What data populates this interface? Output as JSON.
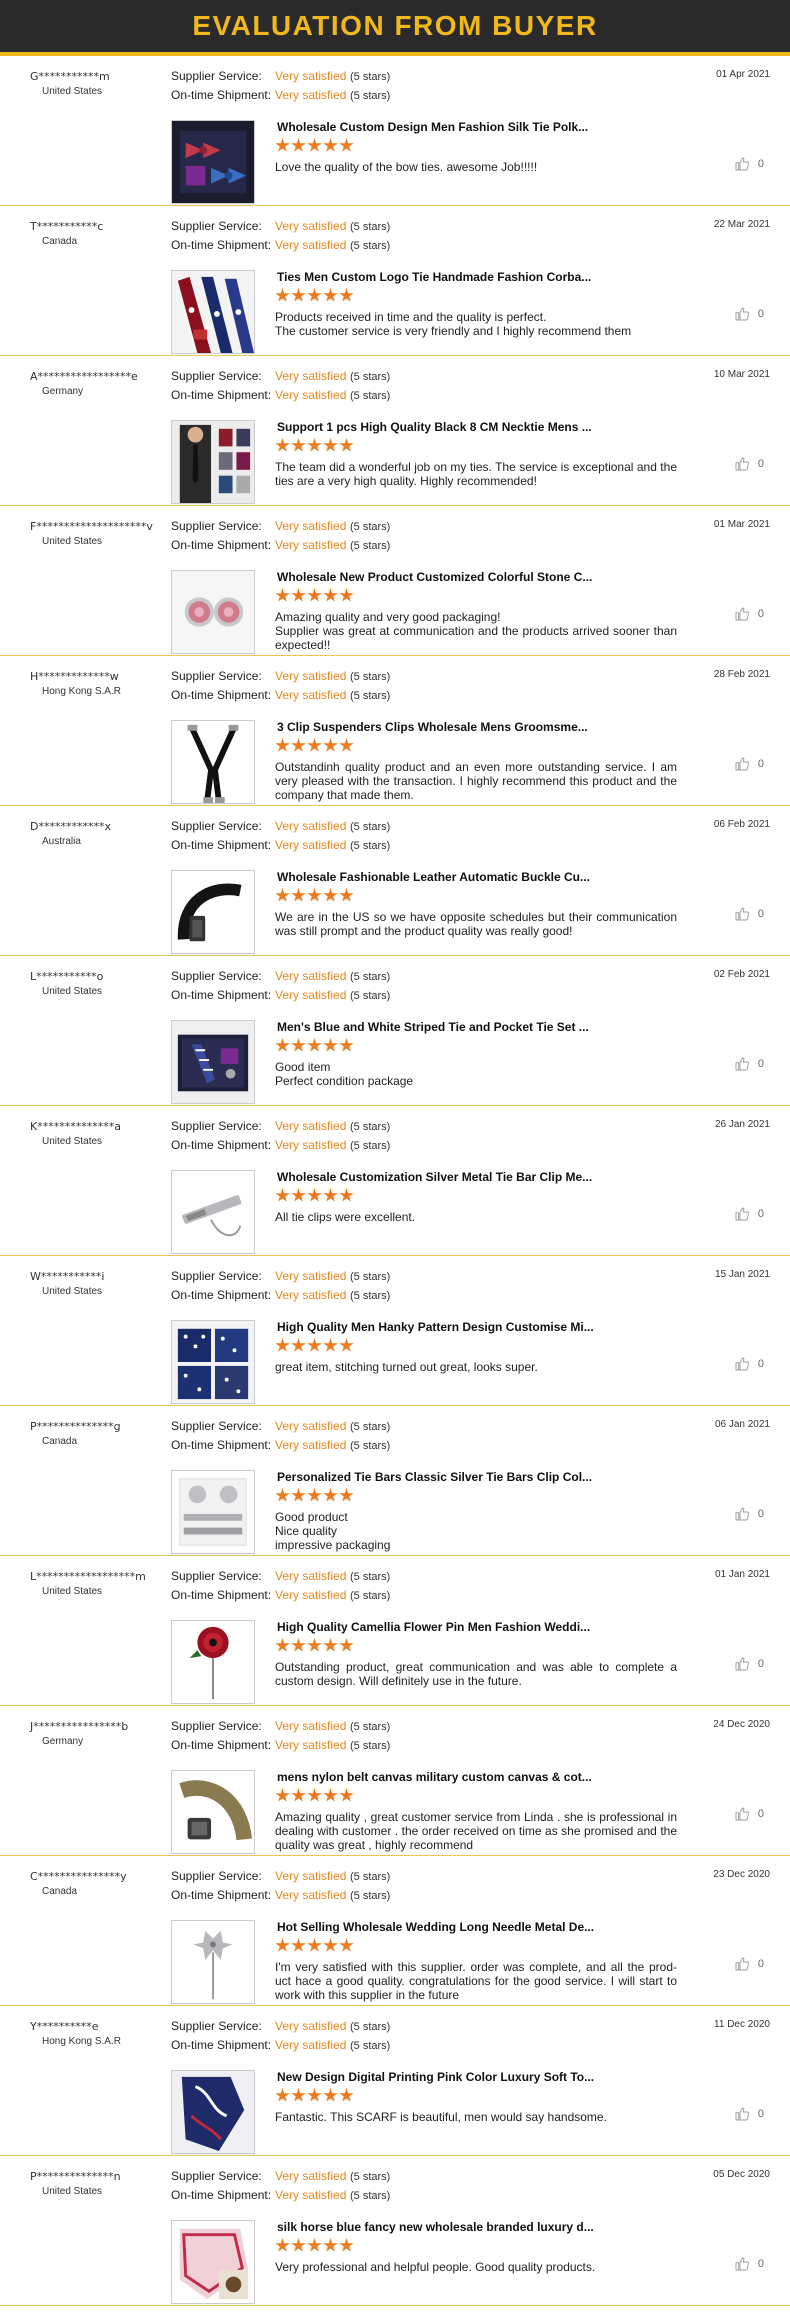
{
  "page_title": "EVALUATION FROM BUYER",
  "labels": {
    "supplier_service": "Supplier Service:",
    "shipment": "On-time Shipment:"
  },
  "colors": {
    "header_bg": "#2a2a2a",
    "accent": "#f0b81a",
    "satisfied": "#e8861a",
    "stars": "#f07b1c"
  },
  "reviews": [
    {
      "buyer": "G***********m",
      "country": "United States",
      "date": "01 Apr 2021",
      "supplier_rating": "Very satisfied",
      "supplier_stars": "(5 stars)",
      "shipment_rating": "Very satisfied",
      "shipment_stars": "(5 stars)",
      "product": "Wholesale Custom Design Men Fashion Silk Tie Polk...",
      "rating": 5,
      "comment": "Love the quality of the bow ties. awesome Job!!!!!",
      "likes": "0",
      "image": "bow-ties-gift-box"
    },
    {
      "buyer": "T***********c",
      "country": "Canada",
      "date": "22 Mar 2021",
      "supplier_rating": "Very satisfied",
      "supplier_stars": "(5 stars)",
      "shipment_rating": "Very satisfied",
      "shipment_stars": "(5 stars)",
      "product": "Ties Men Custom Logo Tie Handmade Fashion Corba...",
      "rating": 5,
      "comment": "Products received in time and the quality is perfect.\nThe customer service is very friendly and I highly recommend them",
      "likes": "0",
      "image": "logo-ties"
    },
    {
      "buyer": "A*****************e",
      "country": "Germany",
      "date": "10 Mar 2021",
      "supplier_rating": "Very satisfied",
      "supplier_stars": "(5 stars)",
      "shipment_rating": "Very satisfied",
      "shipment_stars": "(5 stars)",
      "product": "Support 1 pcs High Quality Black 8 CM Necktie Mens ...",
      "rating": 5,
      "comment": "The team did a wonderful job on my ties. The service is exceptional and the ties are a very high quality. Highly recommended!",
      "likes": "0",
      "image": "man-in-suit-ties"
    },
    {
      "buyer": "F********************v",
      "country": "United States",
      "date": "01 Mar 2021",
      "supplier_rating": "Very satisfied",
      "supplier_stars": "(5 stars)",
      "shipment_rating": "Very satisfied",
      "shipment_stars": "(5 stars)",
      "product": "Wholesale New Product Customized Colorful Stone C...",
      "rating": 5,
      "comment": "Amazing quality and very good packaging!\nSupplier was great at communication and the products arrived sooner than expected!!",
      "likes": "0",
      "image": "stone-cufflinks"
    },
    {
      "buyer": "H*************w",
      "country": "Hong Kong S.A.R",
      "date": "28 Feb 2021",
      "supplier_rating": "Very satisfied",
      "supplier_stars": "(5 stars)",
      "shipment_rating": "Very satisfied",
      "shipment_stars": "(5 stars)",
      "product": "3 Clip Suspenders Clips Wholesale Mens Groomsme...",
      "rating": 5,
      "comment": "Outstandinh quality product and an even more outstanding service. I am very pleased with the transaction. I highly recommend this product and the company that made them.",
      "likes": "0",
      "image": "suspenders"
    },
    {
      "buyer": "D************x",
      "country": "Australia",
      "date": "06 Feb 2021",
      "supplier_rating": "Very satisfied",
      "supplier_stars": "(5 stars)",
      "shipment_rating": "Very satisfied",
      "shipment_stars": "(5 stars)",
      "product": "Wholesale Fashionable Leather Automatic Buckle Cu...",
      "rating": 5,
      "comment": "We are in the US so we have opposite schedules but their communication was still prompt and the product quality was really good!",
      "likes": "0",
      "image": "leather-belt"
    },
    {
      "buyer": "L***********o",
      "country": "United States",
      "date": "02 Feb 2021",
      "supplier_rating": "Very satisfied",
      "supplier_stars": "(5 stars)",
      "shipment_rating": "Very satisfied",
      "shipment_stars": "(5 stars)",
      "product": "Men's Blue and White Striped Tie and Pocket Tie Set ...",
      "rating": 5,
      "comment": "Good item\nPerfect condition package",
      "likes": "0",
      "image": "tie-gift-set"
    },
    {
      "buyer": "K**************a",
      "country": "United States",
      "date": "26 Jan 2021",
      "supplier_rating": "Very satisfied",
      "supplier_stars": "(5 stars)",
      "shipment_rating": "Very satisfied",
      "shipment_stars": "(5 stars)",
      "product": "Wholesale Customization Silver Metal Tie Bar Clip Me...",
      "rating": 5,
      "comment": "All tie clips were excellent.",
      "likes": "0",
      "image": "tie-clip"
    },
    {
      "buyer": "W***********i",
      "country": "United States",
      "date": "15 Jan 2021",
      "supplier_rating": "Very satisfied",
      "supplier_stars": "(5 stars)",
      "shipment_rating": "Very satisfied",
      "shipment_stars": "(5 stars)",
      "product": "High Quality Men Hanky Pattern Design Customise Mi...",
      "rating": 5,
      "comment": "great item, stitching turned out great,  looks super.",
      "likes": "0",
      "image": "hankies"
    },
    {
      "buyer": "P**************g",
      "country": "Canada",
      "date": "06 Jan 2021",
      "supplier_rating": "Very satisfied",
      "supplier_stars": "(5 stars)",
      "shipment_rating": "Very satisfied",
      "shipment_stars": "(5 stars)",
      "product": "Personalized Tie Bars Classic Silver Tie Bars Clip Col...",
      "rating": 5,
      "comment": "Good product\nNice quality\nimpressive packaging",
      "likes": "0",
      "image": "tie-bars-cufflinks"
    },
    {
      "buyer": "L******************m",
      "country": "United States",
      "date": "01 Jan 2021",
      "supplier_rating": "Very satisfied",
      "supplier_stars": "(5 stars)",
      "shipment_rating": "Very satisfied",
      "shipment_stars": "(5 stars)",
      "product": "High Quality Camellia Flower Pin Men Fashion Weddi...",
      "rating": 5,
      "comment": "Outstanding product, great communication and was able to complete a custom design.  Will definitely use in the future.",
      "likes": "0",
      "image": "flower-pin"
    },
    {
      "buyer": "J****************b",
      "country": "Germany",
      "date": "24 Dec 2020",
      "supplier_rating": "Very satisfied",
      "supplier_stars": "(5 stars)",
      "shipment_rating": "Very satisfied",
      "shipment_stars": "(5 stars)",
      "product": "mens nylon belt canvas military custom canvas & cot...",
      "rating": 5,
      "comment": "Amazing quality , great customer service from Linda . she is  professional in dealing with customer . the order received on time as she promised and the quality was great , highly recommend",
      "likes": "0",
      "image": "canvas-belt"
    },
    {
      "buyer": "C***************y",
      "country": "Canada",
      "date": "23 Dec 2020",
      "supplier_rating": "Very satisfied",
      "supplier_stars": "(5 stars)",
      "shipment_rating": "Very satisfied",
      "shipment_stars": "(5 stars)",
      "product": "Hot Selling Wholesale Wedding Long Needle Metal De...",
      "rating": 5,
      "comment": "I'm very satisfied with this supplier. order was complete, and all the prod- uct hace a good quality. congratulations for the good service. I will start to work with this supplier in the future",
      "likes": "0",
      "image": "metal-pin"
    },
    {
      "buyer": "Y**********e",
      "country": "Hong Kong S.A.R",
      "date": "11 Dec 2020",
      "supplier_rating": "Very satisfied",
      "supplier_stars": "(5 stars)",
      "shipment_rating": "Very satisfied",
      "shipment_stars": "(5 stars)",
      "product": "New Design Digital Printing Pink Color Luxury Soft To...",
      "rating": 5,
      "comment": "Fantastic. This SCARF is beautiful, men would say handsome.",
      "likes": "0",
      "image": "blue-scarf"
    },
    {
      "buyer": "P**************n",
      "country": "United States",
      "date": "05 Dec 2020",
      "supplier_rating": "Very satisfied",
      "supplier_stars": "(5 stars)",
      "shipment_rating": "Very satisfied",
      "shipment_stars": "(5 stars)",
      "product": "silk horse blue fancy new wholesale branded luxury d...",
      "rating": 5,
      "comment": "Very professional and helpful people. Good quality products.",
      "likes": "0",
      "image": "silk-scarf"
    }
  ]
}
